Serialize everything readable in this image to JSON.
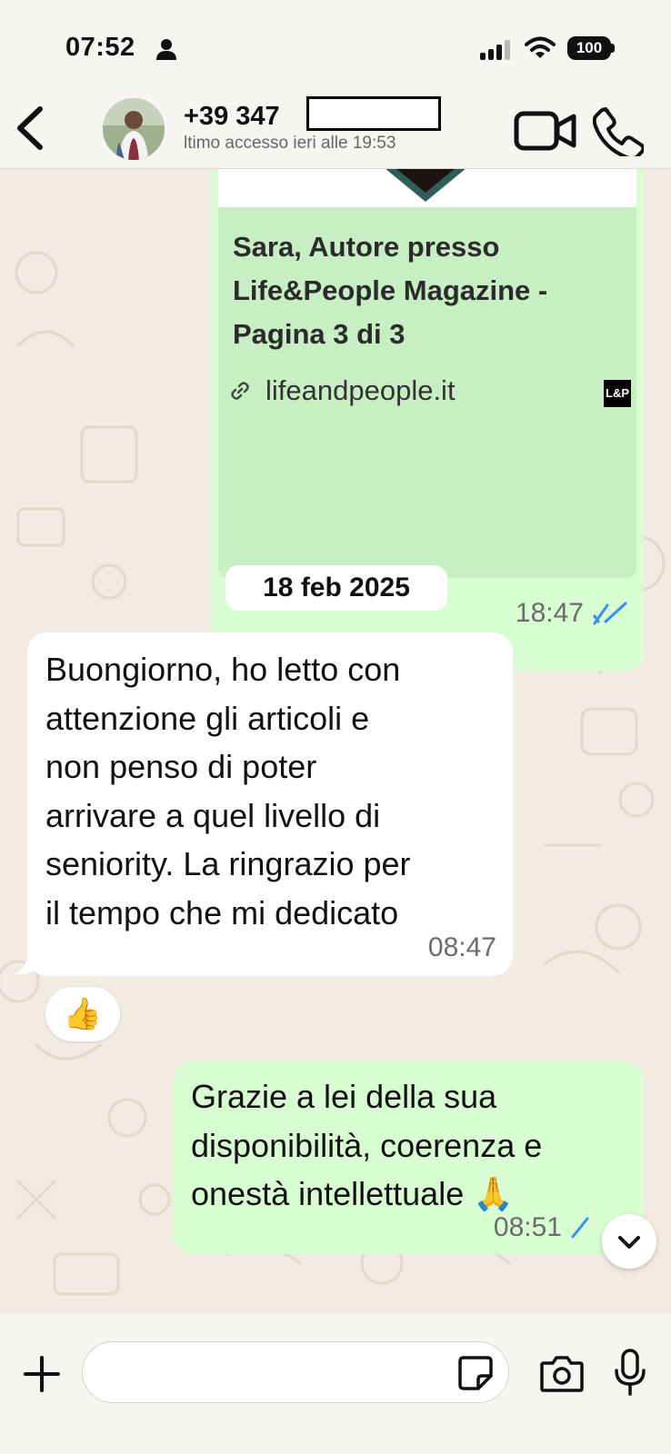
{
  "status_bar": {
    "time": "07:52",
    "battery": "100"
  },
  "header": {
    "contact_name": "+39 347",
    "last_seen": "ltimo accesso ieri alle 19:53"
  },
  "messages": {
    "link_preview": {
      "title": "Sara, Autore presso Life&People Magazine - Pagina 3 di 3",
      "url": "lifeandpeople.it",
      "logo_text": "L&P",
      "time": "18:47",
      "status": "read"
    },
    "date_separator": "18 feb 2025",
    "incoming": {
      "text": "Buongiorno, ho letto con\nattenzione gli articoli e\nnon penso di poter\narrivare a quel livello di\nseniority. La ringrazio per\nil tempo che mi dedicato",
      "time": "08:47",
      "reaction": "👍"
    },
    "outgoing": {
      "text": "Grazie a lei della sua\ndisponibilità, coerenza e\nonestà intellettuale 🙏",
      "time": "08:51",
      "status": "delivered"
    }
  },
  "composer": {
    "placeholder": ""
  },
  "colors": {
    "outgoing_bubble": "#d8fdd2",
    "incoming_bubble": "#ffffff",
    "read_ticks": "#3b8ff0",
    "wallpaper": "#f1ebe2"
  }
}
